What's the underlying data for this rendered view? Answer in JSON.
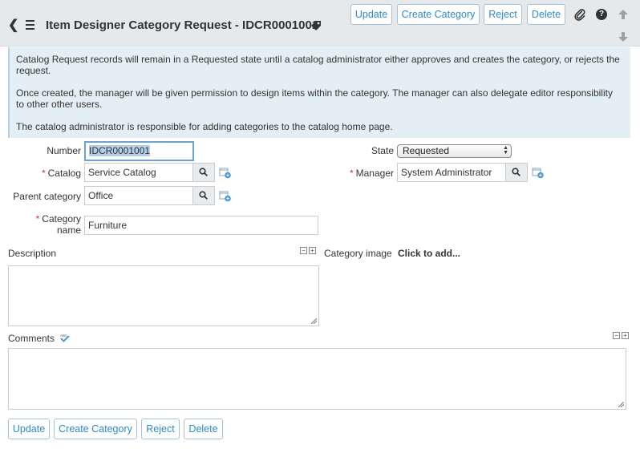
{
  "header": {
    "title": "Item Designer Category Request - IDCR0001001",
    "buttons": {
      "update": "Update",
      "create_category": "Create Category",
      "reject": "Reject",
      "delete": "Delete"
    }
  },
  "info": {
    "p1": "Catalog Request records will remain in a Requested state until a catalog administrator either approves and creates the category, or rejects the request.",
    "p2": "Once created, the manager will be given permission to design items within the category. The manager can also delegate editor responsibility to other other users.",
    "p3": "The catalog administrator is responsible for adding categories to the catalog home page."
  },
  "form": {
    "number": {
      "label": "Number",
      "value": "IDCR0001001"
    },
    "state": {
      "label": "State",
      "value": "Requested"
    },
    "catalog": {
      "label": "Catalog",
      "value": "Service Catalog"
    },
    "manager": {
      "label": "Manager",
      "value": "System Administrator"
    },
    "parent_category": {
      "label": "Parent category",
      "value": "Office"
    },
    "category_name": {
      "label_line1": "Category",
      "label_line2": "name",
      "value": "Furniture"
    },
    "description": {
      "label": "Description"
    },
    "category_image": {
      "label": "Category image",
      "link": "Click to add..."
    },
    "comments": {
      "label": "Comments"
    },
    "required_mark": "*"
  },
  "footer": {
    "buttons": {
      "update": "Update",
      "create_category": "Create Category",
      "reject": "Reject",
      "delete": "Delete"
    }
  },
  "icons": [
    "back-icon",
    "menu-icon",
    "tag-icon",
    "paperclip-icon",
    "help-icon",
    "arrow-up-icon",
    "arrow-down-icon",
    "search-icon",
    "reference-icon",
    "spellcheck-icon"
  ],
  "colors": {
    "accent": "#2e8ac8",
    "header_bg": "#e6e9eb",
    "info_bg": "#e4eef5",
    "required": "#c0392b",
    "focus": "#6aa4d8"
  }
}
